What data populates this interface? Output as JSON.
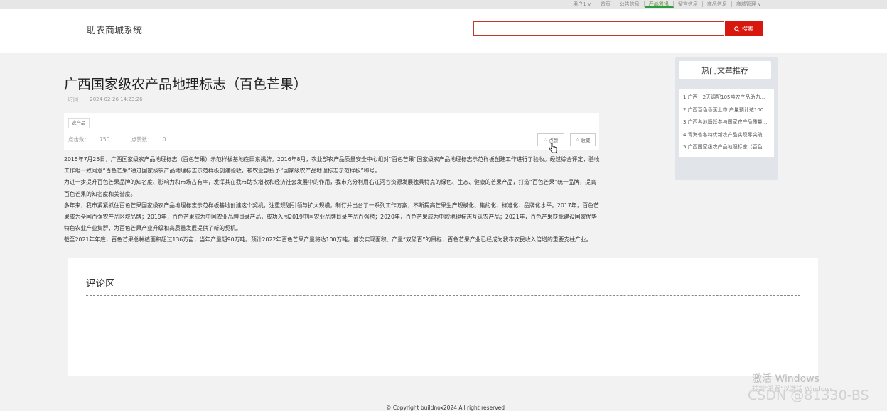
{
  "top_nav": {
    "items": [
      {
        "label": "用户1 ∨"
      },
      {
        "label": "首页"
      },
      {
        "label": "公告信息"
      },
      {
        "label": "产品资讯"
      },
      {
        "label": "留言信息"
      },
      {
        "label": "商品信息"
      },
      {
        "label": "商城管理 ∨"
      }
    ],
    "active_index": 3
  },
  "header": {
    "site_name": "助农商城系统",
    "search": {
      "value": "",
      "button_label": "搜索"
    }
  },
  "article": {
    "title": "广西国家级农产品地理标志（百色芒果）",
    "time_label": "时间",
    "time": "2024-02-26 14:23:26",
    "tag": "农产品",
    "views_label": "点击数：",
    "views": "750",
    "likes_label": "点赞数：",
    "likes": "0",
    "like_button": "点赞",
    "favorite_button": "收藏",
    "paragraphs": [
      "2015年7月25日，广西国家级农产品地理标志（百色芒果）示范样板基地在田东揭牌。2016年8月，农业部农产品质量安全中心组对“百色芒果”国家级农产品地理标志示范样板创建工作进行了验收。经过综合评定，验收工作组一致同意“百色芒果”通过国家级农产品地理标志示范样板创建验收，被农业部授予“国家级农产品地理标志示范样板”称号。",
      "为进一步提升百色芒果品牌的知名度、影响力和市场占有率，发挥其在我市助农增收和经济社会发展中的作用，我市充分利用右江河谷资源发展独具特点的绿色、生态、健康的芒果产品，打造“百色芒果”统一品牌，提高百色芒果的知名度和美誉度。",
      "多年来，我市紧紧抓住百色芒果国家级农产品地理标志示范样板基地创建这个契机，注重规划引领与扩大规模，制订并出台了一系列工作方案，不断提高芒果生产规模化、集约化、标准化、品牌化水平。2017年，百色芒果成为全国百强农产品区域品牌；2019年，百色芒果成为中国农业品牌目录产品，成功入围2019中国农业品牌目录产品百强榜；2020年，百色芒果成为中欧地理标志互认农产品；2021年，百色芒果获批建设国家优势特色农业产业集群，为百色芒果产业升级和高质量发展提供了新的契机。",
      "截至2021年年底，百色芒果总种植面积超过136万亩，当年产量超90万吨。预计2022年百色芒果产量将达100万吨，首次实现面积、产量“双破百”的目标，百色芒果产业已经成为我市农民收入倍增的重要支柱产业。"
    ]
  },
  "sidebar": {
    "title": "热门文章推荐",
    "items": [
      {
        "label": "1 广西：2天调配105吨农产品助力..."
      },
      {
        "label": "2 广西百色香蕉上市 产量预计达100..."
      },
      {
        "label": "3 广西各地踊跃参与国家农产品质量..."
      },
      {
        "label": "4 青海省各特优新农产品实现零突破"
      },
      {
        "label": "5 广西国家级农产品地理标志（百色..."
      }
    ]
  },
  "comments": {
    "title": "评论区"
  },
  "footer": {
    "copyright": "© Copyright buildnox2024   All right reserved"
  },
  "watermarks": {
    "activate_title": "激活 Windows",
    "activate_sub": "转到\"设置\"以激活 Windows。",
    "csdn": "CSDN @81330-BS"
  },
  "colors": {
    "accent": "#d8180f",
    "nav_active": "#2e9d3e",
    "sidebar_bg": "#e1e4e8"
  }
}
